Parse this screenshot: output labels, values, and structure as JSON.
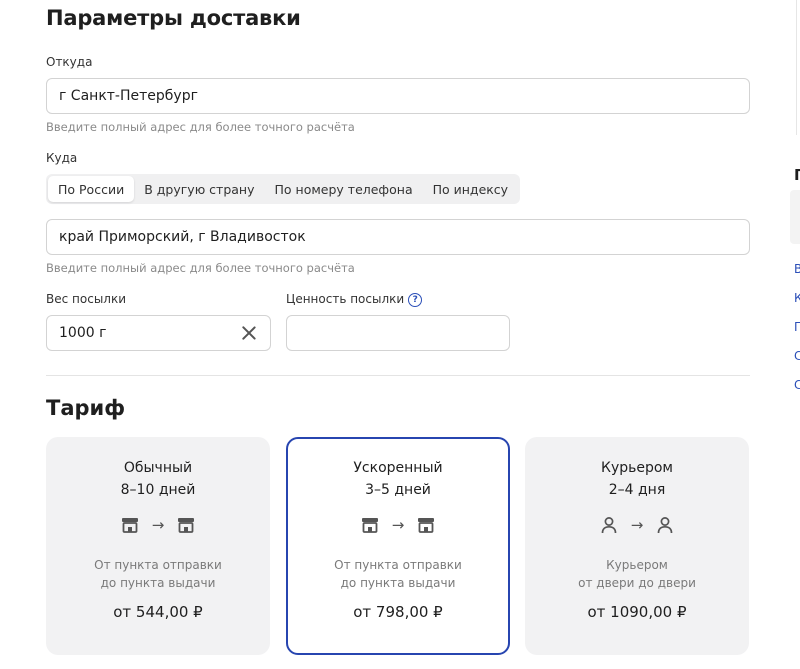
{
  "page_title": "Параметры доставки",
  "from": {
    "label": "Откуда",
    "value": "г Санкт-Петербург",
    "hint": "Введите полный адрес для более точного расчёта"
  },
  "to": {
    "label": "Куда",
    "tabs": [
      "По России",
      "В другую страну",
      "По номеру телефона",
      "По индексу"
    ],
    "active_tab": "По России",
    "value": "край Приморский, г Владивосток",
    "hint": "Введите полный адрес для более точного расчёта"
  },
  "weight": {
    "label": "Вес посылки",
    "value": "1000 г"
  },
  "declared_value": {
    "label": "Ценность посылки",
    "value": ""
  },
  "tariff": {
    "title": "Тариф",
    "cards": [
      {
        "name": "Обычный",
        "days": "8–10 дней",
        "icon_from": "pickup-point-icon",
        "icon_to": "pickup-point-icon",
        "desc_line1": "От пункта отправки",
        "desc_line2": "до пункта выдачи",
        "price": "от 544,00 ₽",
        "selected": false
      },
      {
        "name": "Ускоренный",
        "days": "3–5 дней",
        "icon_from": "pickup-point-icon",
        "icon_to": "pickup-point-icon",
        "desc_line1": "От пункта отправки",
        "desc_line2": "до пункта выдачи",
        "price": "от 798,00 ₽",
        "selected": true
      },
      {
        "name": "Курьером",
        "days": "2–4 дня",
        "icon_from": "person-icon",
        "icon_to": "person-icon",
        "desc_line1": "Курьером",
        "desc_line2": "от двери до двери",
        "price": "от 1090,00 ₽",
        "selected": false
      }
    ]
  },
  "side_cropped": {
    "heading": "П",
    "links": [
      "В",
      "К",
      "П",
      "С",
      "С"
    ]
  },
  "colors": {
    "accent": "#2745b0",
    "card_bg": "#f2f2f3",
    "hint": "#8a8a8a"
  }
}
